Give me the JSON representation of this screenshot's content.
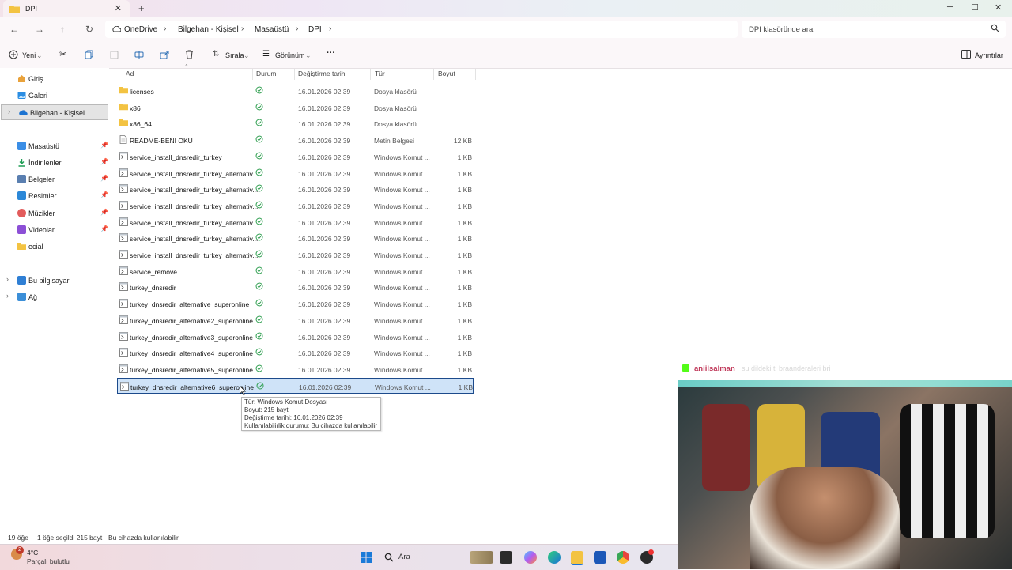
{
  "window": {
    "tab_title": "DPI",
    "new_tab": "+",
    "close_tab": "✕",
    "win_min": "─",
    "win_max": "☐",
    "win_close": "✕"
  },
  "address": {
    "crumbs": [
      "OneDrive",
      "Bilgehan - Kişisel",
      "Masaüstü",
      "DPI"
    ],
    "search_placeholder": "DPI klasöründe ara"
  },
  "toolbar": {
    "new_label": "Yeni",
    "sort_label": "Sırala",
    "view_label": "Görünüm",
    "more_label": "···",
    "details_label": "Ayrıntılar"
  },
  "sidebar": {
    "top": [
      {
        "label": "Giriş"
      },
      {
        "label": "Galeri"
      },
      {
        "label": "Bilgehan - Kişisel"
      }
    ],
    "quick": [
      {
        "label": "Masaüstü"
      },
      {
        "label": "İndirilenler"
      },
      {
        "label": "Belgeler"
      },
      {
        "label": "Resimler"
      },
      {
        "label": "Müzikler"
      },
      {
        "label": "Videolar"
      },
      {
        "label": "ecial"
      }
    ],
    "bottom": [
      {
        "label": "Bu bilgisayar"
      },
      {
        "label": "Ağ"
      }
    ]
  },
  "columns": {
    "name": "Ad",
    "status": "Durum",
    "modified": "Değiştirme tarihi",
    "type": "Tür",
    "size": "Boyut"
  },
  "files": [
    {
      "name": "licenses",
      "date": "16.01.2026 02:39",
      "type": "Dosya klasörü",
      "size": "",
      "kind": "folder"
    },
    {
      "name": "x86",
      "date": "16.01.2026 02:39",
      "type": "Dosya klasörü",
      "size": "",
      "kind": "folder"
    },
    {
      "name": "x86_64",
      "date": "16.01.2026 02:39",
      "type": "Dosya klasörü",
      "size": "",
      "kind": "folder"
    },
    {
      "name": "README-BENI OKU",
      "date": "16.01.2026 02:39",
      "type": "Metin Belgesi",
      "size": "12 KB",
      "kind": "text"
    },
    {
      "name": "service_install_dnsredir_turkey",
      "date": "16.01.2026 02:39",
      "type": "Windows Komut ...",
      "size": "1 KB",
      "kind": "cmd"
    },
    {
      "name": "service_install_dnsredir_turkey_alternativ...",
      "date": "16.01.2026 02:39",
      "type": "Windows Komut ...",
      "size": "1 KB",
      "kind": "cmd"
    },
    {
      "name": "service_install_dnsredir_turkey_alternativ...",
      "date": "16.01.2026 02:39",
      "type": "Windows Komut ...",
      "size": "1 KB",
      "kind": "cmd"
    },
    {
      "name": "service_install_dnsredir_turkey_alternativ...",
      "date": "16.01.2026 02:39",
      "type": "Windows Komut ...",
      "size": "1 KB",
      "kind": "cmd"
    },
    {
      "name": "service_install_dnsredir_turkey_alternativ...",
      "date": "16.01.2026 02:39",
      "type": "Windows Komut ...",
      "size": "1 KB",
      "kind": "cmd"
    },
    {
      "name": "service_install_dnsredir_turkey_alternativ...",
      "date": "16.01.2026 02:39",
      "type": "Windows Komut ...",
      "size": "1 KB",
      "kind": "cmd"
    },
    {
      "name": "service_install_dnsredir_turkey_alternativ...",
      "date": "16.01.2026 02:39",
      "type": "Windows Komut ...",
      "size": "1 KB",
      "kind": "cmd"
    },
    {
      "name": "service_remove",
      "date": "16.01.2026 02:39",
      "type": "Windows Komut ...",
      "size": "1 KB",
      "kind": "cmd"
    },
    {
      "name": "turkey_dnsredir",
      "date": "16.01.2026 02:39",
      "type": "Windows Komut ...",
      "size": "1 KB",
      "kind": "cmd"
    },
    {
      "name": "turkey_dnsredir_alternative_superonline",
      "date": "16.01.2026 02:39",
      "type": "Windows Komut ...",
      "size": "1 KB",
      "kind": "cmd"
    },
    {
      "name": "turkey_dnsredir_alternative2_superonline",
      "date": "16.01.2026 02:39",
      "type": "Windows Komut ...",
      "size": "1 KB",
      "kind": "cmd"
    },
    {
      "name": "turkey_dnsredir_alternative3_superonline",
      "date": "16.01.2026 02:39",
      "type": "Windows Komut ...",
      "size": "1 KB",
      "kind": "cmd"
    },
    {
      "name": "turkey_dnsredir_alternative4_superonline",
      "date": "16.01.2026 02:39",
      "type": "Windows Komut ...",
      "size": "1 KB",
      "kind": "cmd"
    },
    {
      "name": "turkey_dnsredir_alternative5_superonline",
      "date": "16.01.2026 02:39",
      "type": "Windows Komut ...",
      "size": "1 KB",
      "kind": "cmd"
    },
    {
      "name": "turkey_dnsredir_alternative6_superonline",
      "date": "16.01.2026 02:39",
      "type": "Windows Komut ...",
      "size": "1 KB",
      "kind": "cmd",
      "selected": true
    }
  ],
  "tooltip": {
    "line1": "Tür: Windows Komut Dosyası",
    "line2": "Boyut: 215 bayt",
    "line3": "Değiştirme tarihi: 16.01.2026 02:39",
    "line4": "Kullanılabilirlik durumu: Bu cihazda kullanılabilir"
  },
  "status": {
    "count": "19 öğe",
    "selection": "1 öğe seçildi  215 bayt",
    "availability": "Bu cihazda kullanılabilir"
  },
  "taskbar": {
    "weather_temp": "4°C",
    "weather_desc": "Parçalı bulutlu",
    "weather_badge": "2",
    "search_label": "Ara"
  },
  "chat": {
    "username": "aniilsalman",
    "message": "su dildeki ti braanderaleri bri"
  },
  "colors": {
    "selection_bg": "#cfe3f8",
    "selection_border": "#1c4a8b",
    "sync_green": "#2e9e4f",
    "folder": "#f3c342",
    "chat_name": "#c0395a"
  }
}
